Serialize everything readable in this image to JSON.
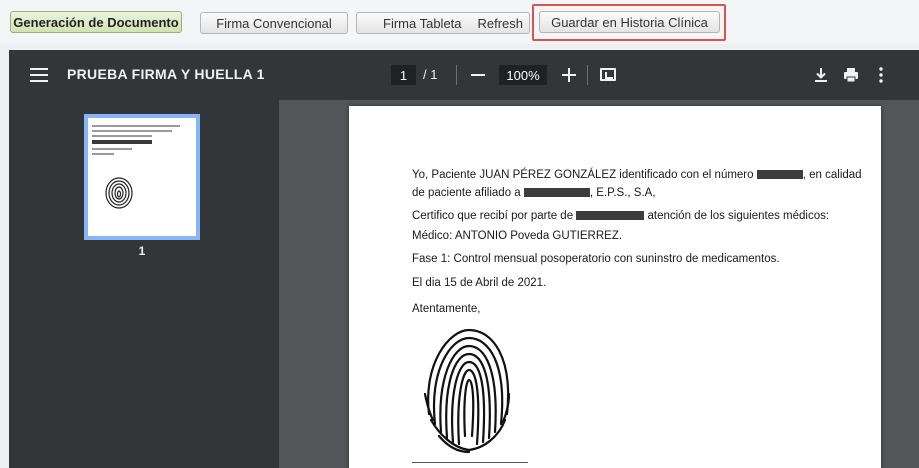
{
  "toolbar": {
    "generate_label": "Generación de Documento",
    "firma_conv_label": "Firma Convencional",
    "firma_tableta_label": "Firma Tableta",
    "refresh_label": "Refresh",
    "guardar_label": "Guardar en Historia Clínica"
  },
  "viewer": {
    "title": "PRUEBA FIRMA Y HUELLA 1",
    "page_current": "1",
    "page_total": "/ 1",
    "zoom": "100%",
    "thumbnail_label": "1"
  },
  "document": {
    "l1_a": "Yo, Paciente JUAN PÉREZ GONZÁLEZ identificado con el número",
    "l1_b": ", en calidad",
    "l2_a": "de paciente afiliado a",
    "l2_b": ", E.P.S., S.A,",
    "l3_a": "Certifico que recibí por parte de",
    "l3_b": "atención de los siguientes médicos:",
    "l4": "Médico: ANTONIO Poveda GUTIERREZ.",
    "l5": "Fase 1: Control mensual posoperatorio con suninstro de medicamentos.",
    "l6": "El dia 15 de Abril de 2021.",
    "l7": "Atentamente,"
  },
  "colors": {
    "accent_highlight": "#d9534f",
    "thumbnail_selected": "#8ab4f8",
    "viewer_toolbar": "#323639"
  },
  "icons": [
    "menu-icon",
    "zoom-out-icon",
    "zoom-in-icon",
    "fit-page-icon",
    "download-icon",
    "print-icon",
    "more-options-icon",
    "fingerprint"
  ]
}
